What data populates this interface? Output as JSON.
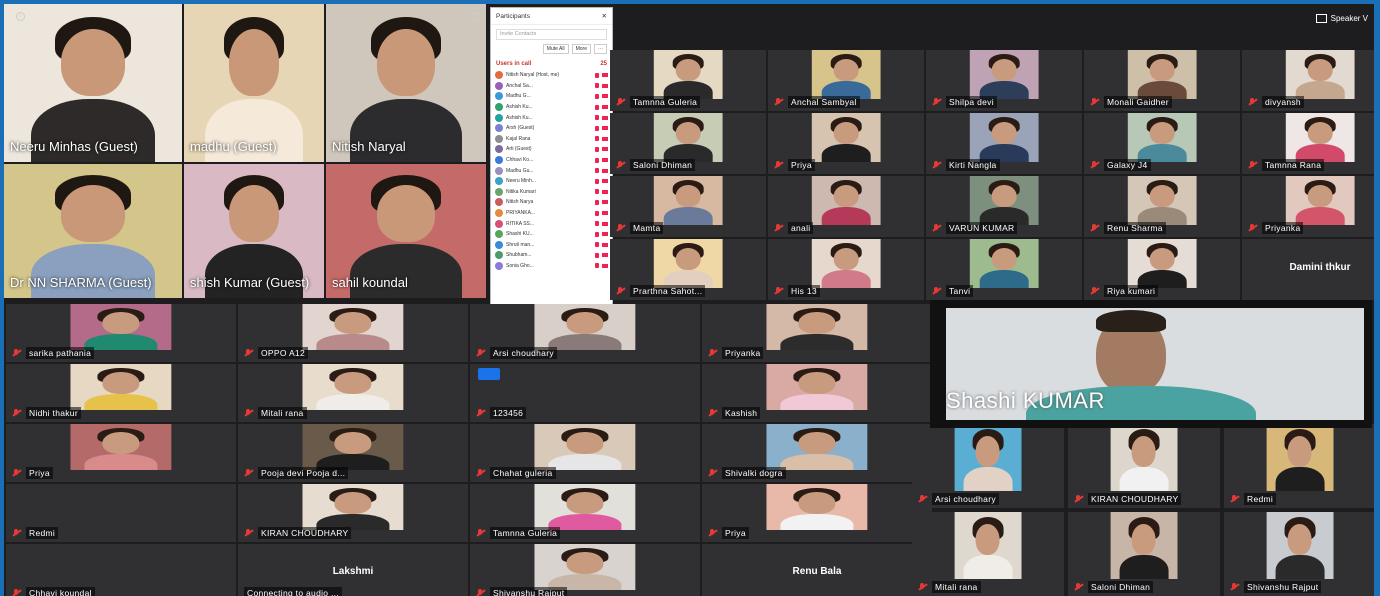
{
  "window": {
    "speaker_view_label": "Speaker V"
  },
  "gallery_main": [
    {
      "name": "Neeru Minhas (Guest)",
      "bg": "#ece6dd",
      "shirt": "#2e2a2a"
    },
    {
      "name": "madhu (Guest)",
      "bg": "#e7d6b5",
      "shirt": "#f5e9d9"
    },
    {
      "name": "Nitish Naryal",
      "bg": "#cfc7bb",
      "shirt": "#2c2b2e"
    },
    {
      "name": "Dr NN SHARMA (Guest)",
      "bg": "#d4c68a",
      "shirt": "#8aa0be"
    },
    {
      "name": "shish Kumar (Guest)",
      "bg": "#d8b9c4",
      "shirt": "#232323"
    },
    {
      "name": "sahil koundal",
      "bg": "#c46a68",
      "shirt": "#2b2b2b"
    }
  ],
  "participants_panel": {
    "title": "Participants",
    "search_placeholder": "Invite Contacts",
    "btn_mute_all": "Mute All",
    "btn_more": "More",
    "section_title": "Users in call",
    "section_count": "25",
    "items": [
      {
        "label": "Nitish Naryal (Host, me)",
        "color": "#e46b3c"
      },
      {
        "label": "Anchal Sa...",
        "color": "#9a5fbb"
      },
      {
        "label": "Madhu G...",
        "color": "#3a9ad9"
      },
      {
        "label": "Ashish Ku...",
        "color": "#2fa36b"
      },
      {
        "label": "Ashish Ku...",
        "color": "#1fa3a3"
      },
      {
        "label": "Arsh (Guest)",
        "color": "#7a7fd1"
      },
      {
        "label": "Kajal Rana",
        "color": "#8d8d8d"
      },
      {
        "label": "Arti (Guest)",
        "color": "#7b6b9b"
      },
      {
        "label": "Chhavi Ko...",
        "color": "#3b7ad9"
      },
      {
        "label": "Madhu Gu...",
        "color": "#9a8fbf"
      },
      {
        "label": "Neeru Minh...",
        "color": "#3aa3c9"
      },
      {
        "label": "Nitika Kumari",
        "color": "#6ba36b"
      },
      {
        "label": "Nitish Narya",
        "color": "#c95c5c"
      },
      {
        "label": "PRIYANKA...",
        "color": "#e48a3c"
      },
      {
        "label": "RITIKA SS...",
        "color": "#d94f7a"
      },
      {
        "label": "Shashi KU...",
        "color": "#5aa35a"
      },
      {
        "label": "Shruti man...",
        "color": "#3a8ad9"
      },
      {
        "label": "Shubham...",
        "color": "#4b9b6b"
      },
      {
        "label": "Sonia Gho...",
        "color": "#8a7ad9"
      }
    ]
  },
  "grid_right": [
    [
      {
        "name": "Tamnna Guleria",
        "bg": "#e6d9c4",
        "shirt": "#2a2a2a"
      },
      {
        "name": "Anchal Sambyal",
        "bg": "#d6c48a",
        "shirt": "#3a6a9a"
      },
      {
        "name": "Shilpa devi",
        "bg": "#bfa3b5",
        "shirt": "#2c3e5a"
      },
      {
        "name": "Monali Gaidher",
        "bg": "#cdbfa8",
        "shirt": "#6a4a3a"
      },
      {
        "name": "divyansh",
        "bg": "#e2dad0",
        "shirt": "#c4a78e"
      }
    ],
    [
      {
        "name": "Saloni Dhiman",
        "bg": "#c7ccb5",
        "shirt": "#2a2a2a"
      },
      {
        "name": "Priya",
        "bg": "#d6c4b0",
        "shirt": "#1e1e1e"
      },
      {
        "name": "Kirti Nangla",
        "bg": "#9aa3b8",
        "shirt": "#2a3a5a"
      },
      {
        "name": "Galaxy J4",
        "bg": "#b7c9b6",
        "shirt": "#4a8a9a"
      },
      {
        "name": "Tamnna Rana",
        "bg": "#efe6e6",
        "shirt": "#d14a6a"
      }
    ],
    [
      {
        "name": "Mamta",
        "bg": "#d7b8a0",
        "shirt": "#6a7a9a"
      },
      {
        "name": "anali",
        "bg": "#cdb9b0",
        "shirt": "#b53a5a"
      },
      {
        "name": "VARUN KUMAR",
        "bg": "#7d8f7f",
        "shirt": "#2a2a2a"
      },
      {
        "name": "Renu Sharma",
        "bg": "#d4c7b8",
        "shirt": "#9a8a7a"
      },
      {
        "name": "Priyanka",
        "bg": "#e2c9c0",
        "shirt": "#d2556a"
      }
    ],
    [
      {
        "name": "Prarthna Sahot...",
        "bg": "#f0d8a6",
        "shirt": "#e2cfc0"
      },
      {
        "name": "His 13",
        "bg": "#e6d8cc",
        "shirt": "#d07a8a"
      },
      {
        "name": "Tanvi",
        "bg": "#9dbb8f",
        "shirt": "#2e6a8a"
      },
      {
        "name": "Riya kumari",
        "bg": "#e5ddd5",
        "shirt": "#1e1e1e"
      },
      {
        "name": "Damini thkur",
        "label_only": true
      }
    ]
  ],
  "grid_left": [
    [
      {
        "name": "sarika pathania",
        "bg": "#b46b8a",
        "shirt": "#1f8a6f"
      },
      {
        "name": "OPPO A12",
        "bg": "#e2d5cf",
        "shirt": "#b88a8a"
      },
      {
        "name": "Arsi choudhary",
        "bg": "#d8d0c8",
        "shirt": "#8a7a7a"
      },
      {
        "name": "Priyanka",
        "bg": "#d4b9a8",
        "shirt": "#2c2c2c"
      }
    ],
    [
      {
        "name": "Nidhi thakur",
        "bg": "#e6d8c3",
        "shirt": "#e7c24a"
      },
      {
        "name": "Mitali rana",
        "bg": "#e8dccc",
        "shirt": "#f0ede8"
      },
      {
        "name": "123456",
        "empty": true
      },
      {
        "name": "Kashish",
        "bg": "#d9a9a3",
        "shirt": "#f0c8d6"
      }
    ],
    [
      {
        "name": "Priya",
        "bg": "#b56a6a",
        "shirt": "#d98a8a"
      },
      {
        "name": "Pooja devi Pooja d...",
        "bg": "#6a5a4a",
        "shirt": "#1e1e1e"
      },
      {
        "name": "Chahat guleria",
        "bg": "#d8c9b9",
        "shirt": "#e6e6e6"
      },
      {
        "name": "Shivalki dogra",
        "bg": "#8ab0cc",
        "shirt": "#d9bfa8"
      }
    ],
    [
      {
        "name": "Redmi",
        "empty": true
      },
      {
        "name": "KIRAN CHOUDHARY",
        "bg": "#e6dccf",
        "shirt": "#2a2a2a"
      },
      {
        "name": "Tamnna Guleria",
        "bg": "#e1e0da",
        "shirt": "#e05aa0"
      },
      {
        "name": "Priya",
        "bg": "#e8b9a8",
        "shirt": "#f2f2f2"
      }
    ],
    [
      {
        "name": "Chhavi koundal",
        "empty": true
      },
      {
        "name": "Connecting to audio ...",
        "label_only": true,
        "center": "Lakshmi"
      },
      {
        "name": "Shivanshu Rajput",
        "bg": "#d8d3cf",
        "shirt": "#c8b7a8"
      },
      {
        "name": "",
        "label_only": true,
        "center": "Renu Bala"
      }
    ]
  ],
  "grid_bottom_right": [
    [
      {
        "name": "Arsi choudhary",
        "bg": "#5aaed4",
        "shirt": "#e2d2c6"
      },
      {
        "name": "KIRAN CHOUDHARY",
        "bg": "#dcd6cc",
        "shirt": "#f1f1f1"
      },
      {
        "name": "Redmi",
        "bg": "#d7b879",
        "shirt": "#1e1e1e"
      }
    ],
    [
      {
        "name": "Mitali rana",
        "bg": "#dfd8cf",
        "shirt": "#f0ede8"
      },
      {
        "name": "Saloni Dhiman",
        "bg": "#c7b5a8",
        "shirt": "#1e1e1e"
      },
      {
        "name": "Shivanshu Rajput",
        "bg": "#c8ccd0",
        "shirt": "#2a2a2a"
      }
    ]
  ],
  "speaker": {
    "name": "Shashi KUMAR",
    "shirt": "#4aa3a0"
  }
}
